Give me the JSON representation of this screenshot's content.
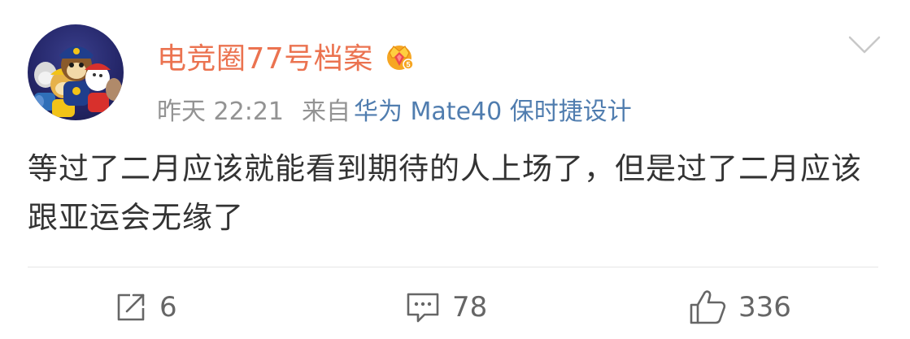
{
  "post": {
    "username": "电竞圈77号档案",
    "time": "昨天 22:21",
    "source_prefix": "来自",
    "device": "华为 Mate40 保时捷设计",
    "text": "等过了二月应该就能看到期待的人上场了，但是过了二月应该跟亚运会无缘了"
  },
  "icons": {
    "avatar": "paw-patrol-avatar",
    "badge": "vip-crown-icon",
    "menu": "chevron-down-icon",
    "repost": "repost-icon",
    "comment": "comment-icon",
    "like": "thumbs-up-icon"
  },
  "actions": {
    "repost_count": "6",
    "comment_count": "78",
    "like_count": "336"
  },
  "colors": {
    "username": "#eb7350",
    "device_link": "#507daf",
    "meta": "#939393",
    "text": "#333333",
    "action": "#666666"
  }
}
